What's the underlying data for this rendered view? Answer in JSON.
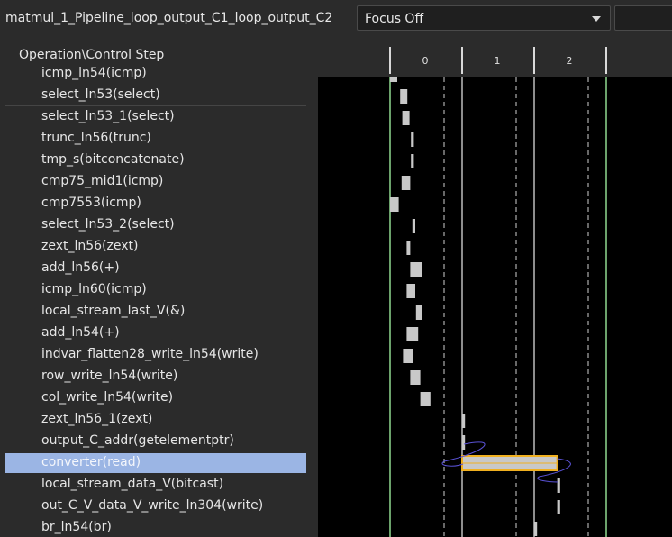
{
  "title": "matmul_1_Pipeline_loop_output_C1_loop_output_C2",
  "focus": {
    "value": "Focus Off"
  },
  "operations_header": "Operation\\Control Step",
  "control_steps": [
    "0",
    "1",
    "2"
  ],
  "operations": [
    {
      "label": "icmp_ln54(icmp)",
      "start_step": 0.0,
      "width_steps": 0.1
    },
    {
      "label": "select_ln53(select)",
      "start_step": 0.14,
      "width_steps": 0.1
    },
    {
      "label": "select_ln53_1(select)",
      "start_step": 0.17,
      "width_steps": 0.1
    },
    {
      "label": "trunc_ln56(trunc)",
      "start_step": 0.29,
      "width_steps": 0.04
    },
    {
      "label": "tmp_s(bitconcatenate)",
      "start_step": 0.29,
      "width_steps": 0.04
    },
    {
      "label": "cmp75_mid1(icmp)",
      "start_step": 0.16,
      "width_steps": 0.12
    },
    {
      "label": "cmp7553(icmp)",
      "start_step": 0.0,
      "width_steps": 0.12
    },
    {
      "label": "select_ln53_2(select)",
      "start_step": 0.31,
      "width_steps": 0.04
    },
    {
      "label": "zext_ln56(zext)",
      "start_step": 0.23,
      "width_steps": 0.05
    },
    {
      "label": "add_ln56(+)",
      "start_step": 0.28,
      "width_steps": 0.16
    },
    {
      "label": "icmp_ln60(icmp)",
      "start_step": 0.23,
      "width_steps": 0.12
    },
    {
      "label": "local_stream_last_V(&)",
      "start_step": 0.36,
      "width_steps": 0.08
    },
    {
      "label": "add_ln54(+)",
      "start_step": 0.23,
      "width_steps": 0.16
    },
    {
      "label": "indvar_flatten28_write_ln54(write)",
      "start_step": 0.18,
      "width_steps": 0.14
    },
    {
      "label": "row_write_ln54(write)",
      "start_step": 0.28,
      "width_steps": 0.14
    },
    {
      "label": "col_write_ln54(write)",
      "start_step": 0.42,
      "width_steps": 0.14
    },
    {
      "label": "zext_ln56_1(zext)",
      "start_step": 1.0,
      "width_steps": 0.04
    },
    {
      "label": "output_C_addr(getelementptr)",
      "start_step": 1.0,
      "width_steps": 0.04
    },
    {
      "label": "converter(read)",
      "start_step": 1.0,
      "width_steps": 1.32,
      "selected": true
    },
    {
      "label": "local_stream_data_V(bitcast)",
      "start_step": 2.32,
      "width_steps": 0.04
    },
    {
      "label": "out_C_V_data_V_write_ln304(write)",
      "start_step": 2.32,
      "width_steps": 0.04
    },
    {
      "label": "br_ln54(br)",
      "start_step": 2.0,
      "width_steps": 0.04
    }
  ],
  "colors": {
    "bar": "#c8c8c8",
    "selected_bar_fill": "#c8c8c8",
    "selected_bar_border": "#f0b020",
    "dependency_arrow": "#5a52d6",
    "clock_line": "#8fd98f",
    "selected_row": "#9bb5e4"
  }
}
